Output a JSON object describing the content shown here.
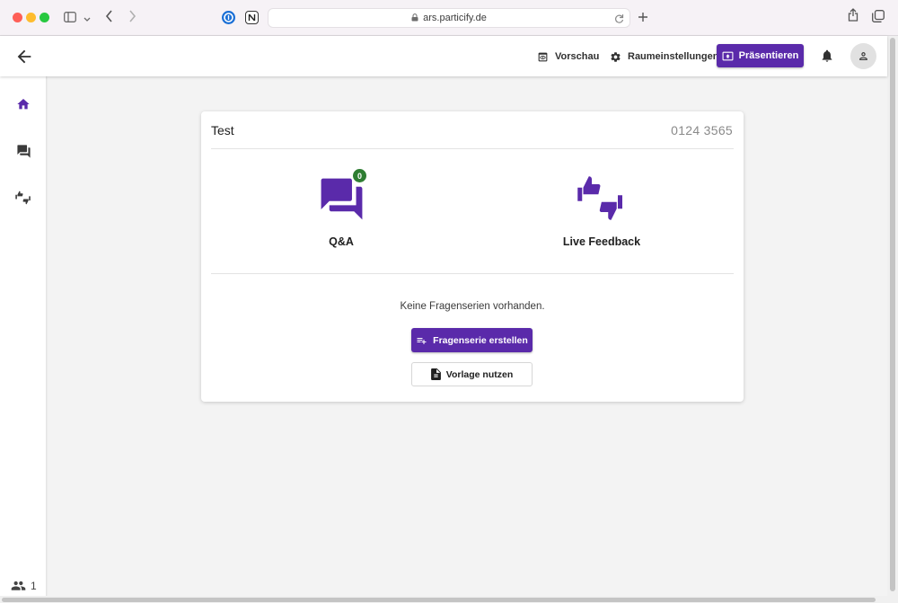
{
  "browser": {
    "url": "ars.particify.de",
    "icons": [
      "sidebar-icon",
      "chevron-down-icon",
      "back-icon",
      "forward-icon",
      "password-manager-icon",
      "notion-icon",
      "reload-icon",
      "new-tab-icon",
      "share-icon",
      "tabs-overview-icon"
    ]
  },
  "header": {
    "preview_label": "Vorschau",
    "room_settings_label": "Raumeinstellungen",
    "present_label": "Präsentieren"
  },
  "sidebar": {
    "items": [
      {
        "name": "home",
        "icon": "home-icon",
        "active": true
      },
      {
        "name": "qa",
        "icon": "forum-icon",
        "active": false
      },
      {
        "name": "feedback",
        "icon": "thumbs-icon",
        "active": false
      }
    ],
    "online_users": "1"
  },
  "room": {
    "title": "Test",
    "code": "0124 3565",
    "features": [
      {
        "label": "Q&A",
        "badge": "0",
        "icon": "forum-icon"
      },
      {
        "label": "Live Feedback",
        "icon": "thumbs-icon"
      }
    ],
    "empty_message": "Keine Fragenserien vorhanden.",
    "create_label": "Fragenserie erstellen",
    "template_label": "Vorlage nutzen"
  },
  "colors": {
    "accent": "#5a2aaa",
    "badge": "#2e7d32"
  }
}
